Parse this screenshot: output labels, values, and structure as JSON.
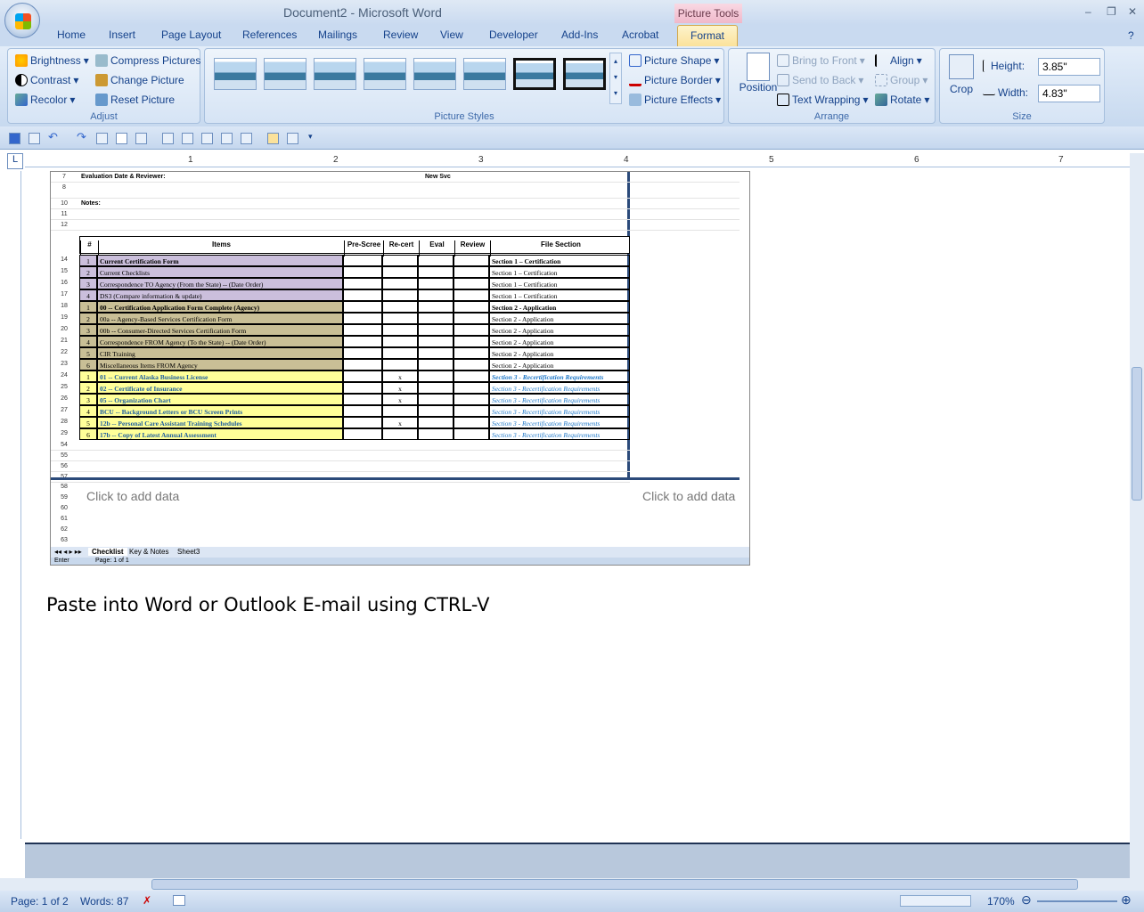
{
  "window": {
    "title": "Document2 - Microsoft Word",
    "context_tab": "Picture Tools"
  },
  "tabs": [
    "Home",
    "Insert",
    "Page Layout",
    "References",
    "Mailings",
    "Review",
    "View",
    "Developer",
    "Add-Ins",
    "Acrobat"
  ],
  "active_tab": "Format",
  "ribbon": {
    "adjust": {
      "label": "Adjust",
      "brightness": "Brightness",
      "contrast": "Contrast",
      "recolor": "Recolor",
      "compress": "Compress Pictures",
      "change": "Change Picture",
      "reset": "Reset Picture"
    },
    "styles": {
      "label": "Picture Styles",
      "shape": "Picture Shape",
      "border": "Picture Border",
      "effects": "Picture Effects"
    },
    "arrange": {
      "label": "Arrange",
      "position": "Position",
      "front": "Bring to Front",
      "back": "Send to Back",
      "wrap": "Text Wrapping",
      "align": "Align",
      "group": "Group",
      "rotate": "Rotate"
    },
    "size": {
      "label": "Size",
      "crop": "Crop",
      "height_label": "Height:",
      "height_value": "3.85\"",
      "width_label": "Width:",
      "width_value": "4.83\""
    }
  },
  "ruler": [
    "1",
    "2",
    "3",
    "4",
    "5",
    "6",
    "7"
  ],
  "sheet": {
    "header_rows": [
      {
        "n": "7",
        "a": "Evaluation Date & Reviewer:",
        "b": "New Svc"
      },
      {
        "n": "8",
        "a": "",
        "b": ""
      },
      {
        "n": "10",
        "a": "Notes:",
        "b": ""
      },
      {
        "n": "11",
        "a": "",
        "b": ""
      },
      {
        "n": "12",
        "a": "",
        "b": ""
      }
    ],
    "columns": [
      "#",
      "Items",
      "Pre-Scree",
      "Re-cert",
      "Eval",
      "Review",
      "File Section"
    ],
    "rows": [
      {
        "n": "14",
        "num": "1",
        "item": "Current Certification Form",
        "rc": "",
        "sec": "Section 1 – Certification",
        "c": "purple",
        "bold": true
      },
      {
        "n": "15",
        "num": "2",
        "item": "Current Checklists",
        "rc": "",
        "sec": "Section 1 – Certification",
        "c": "purple"
      },
      {
        "n": "16",
        "num": "3",
        "item": "Correspondence TO Agency (From the State) -- (Date Order)",
        "rc": "",
        "sec": "Section 1 – Certification",
        "c": "purple"
      },
      {
        "n": "17",
        "num": "4",
        "item": "DS3 (Compare information & update)",
        "rc": "",
        "sec": "Section 1 – Certification",
        "c": "purple"
      },
      {
        "n": "18",
        "num": "1",
        "item": "00 -- Certification Application Form Complete (Agency)",
        "rc": "",
        "sec": "Section 2 - Application",
        "c": "tan",
        "bold": true
      },
      {
        "n": "19",
        "num": "2",
        "item": "00a -- Agency-Based Services Certification Form",
        "rc": "",
        "sec": "Section 2 - Application",
        "c": "tan"
      },
      {
        "n": "20",
        "num": "3",
        "item": "00b -- Consumer-Directed Services Certification Form",
        "rc": "",
        "sec": "Section 2 - Application",
        "c": "tan"
      },
      {
        "n": "21",
        "num": "4",
        "item": "Correspondence FROM Agency (To the State) -- (Date Order)",
        "rc": "",
        "sec": "Section 2 - Application",
        "c": "tan"
      },
      {
        "n": "22",
        "num": "5",
        "item": "CIR Training",
        "rc": "",
        "sec": "Section 2 - Application",
        "c": "tan"
      },
      {
        "n": "23",
        "num": "6",
        "item": "Miscellaneous Items FROM Agency",
        "rc": "",
        "sec": "Section 2 - Application",
        "c": "tan"
      },
      {
        "n": "24",
        "num": "1",
        "item": "01 -- Current Alaska Business License",
        "rc": "x",
        "sec": "Section 3 - Recertification Requirements",
        "c": "yellow",
        "bold": true
      },
      {
        "n": "25",
        "num": "2",
        "item": "02 -- Certificate of Insurance",
        "rc": "x",
        "sec": "Section 3 - Recertification Requirements",
        "c": "yellow"
      },
      {
        "n": "26",
        "num": "3",
        "item": "05 -- Organization Chart",
        "rc": "x",
        "sec": "Section 3 - Recertification Requirements",
        "c": "yellow"
      },
      {
        "n": "27",
        "num": "4",
        "item": "BCU -- Background Letters or BCU Screen Prints",
        "rc": "",
        "sec": "Section 3 - Recertification Requirements",
        "c": "yellow"
      },
      {
        "n": "28",
        "num": "5",
        "item": "12b -- Personal Care Assistant Training Schedules",
        "rc": "x",
        "sec": "Section 3 - Recertification Requirements",
        "c": "yellow"
      },
      {
        "n": "29",
        "num": "6",
        "item": "17b -- Copy of Latest Annual Assessment",
        "rc": "",
        "sec": "Section 3 - Recertification Requirements",
        "c": "yellow"
      }
    ],
    "tail_rows": [
      "54",
      "55",
      "56",
      "57"
    ],
    "data_rows": [
      "58",
      "59",
      "60",
      "61",
      "62",
      "63"
    ],
    "click_to_add": "Click to add data",
    "sheet_tabs": [
      "Checklist",
      "Key & Notes",
      "Sheet3"
    ],
    "status_left": "Enter",
    "status_page": "Page: 1 of 1"
  },
  "paste_text": "Paste into Word or Outlook E-mail using CTRL-V",
  "status": {
    "page": "Page: 1 of 2",
    "words": "Words: 87",
    "zoom": "170%"
  }
}
